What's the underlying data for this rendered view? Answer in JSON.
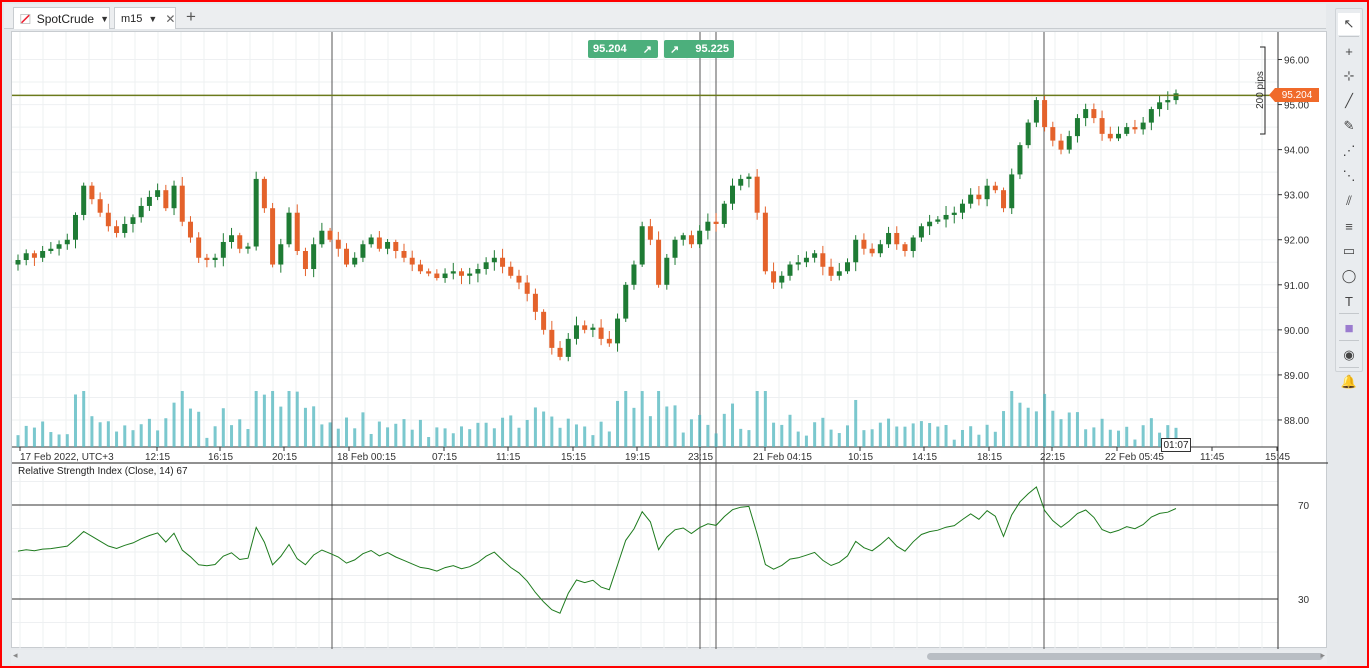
{
  "tabs": [
    {
      "label": "SpotCrude",
      "icon": "instrument-icon"
    },
    {
      "label": "m15",
      "icon": "timeframe-icon"
    }
  ],
  "add_tab_glyph": "+",
  "badges": {
    "sell": "95.204",
    "buy": "95.225"
  },
  "price_tag": "95.204",
  "time_tag": "01:07",
  "pips_label": "200 pips",
  "rsi_title": "Relative Strength Index (Close, 14) 67",
  "colors": {
    "up": "#1e7b34",
    "down": "#e4622b",
    "volume": "#4fb6bd",
    "rsi": "#1e7b1e",
    "hline": "#6b7a1c",
    "tag": "#f06a2a",
    "badge": "#4caf7c"
  },
  "toolbar": [
    "pointer-icon",
    "crosshair-icon",
    "crosshair-plus-icon",
    "line-icon",
    "brush-icon",
    "fib-icon",
    "fib-fan-icon",
    "channel-icon",
    "fib-retracement-icon",
    "rectangle-icon",
    "ellipse-icon",
    "text-icon",
    "color-swatch-icon",
    "camera-icon",
    "bell-icon"
  ],
  "chart_data": {
    "type": "candlestick",
    "price_axis": {
      "ticks": [
        "96.00",
        "95.00",
        "94.00",
        "93.00",
        "92.00",
        "91.00",
        "90.00",
        "89.00",
        "88.00"
      ],
      "range": [
        87.4,
        96.3
      ]
    },
    "time_axis": [
      "17 Feb 2022, UTC+3",
      "12:15",
      "16:15",
      "20:15",
      "18 Feb 00:15",
      "07:15",
      "11:15",
      "15:15",
      "19:15",
      "23:15",
      "21 Feb 04:15",
      "10:15",
      "14:15",
      "18:15",
      "22:15",
      "22 Feb 05:45",
      "11:45",
      "15:45"
    ],
    "horizontal_line": 95.204,
    "close_series": [
      91.55,
      91.7,
      91.6,
      91.75,
      91.8,
      91.9,
      92.0,
      92.55,
      93.2,
      92.9,
      92.6,
      92.3,
      92.15,
      92.35,
      92.5,
      92.75,
      92.95,
      93.1,
      92.7,
      93.2,
      92.4,
      92.05,
      91.6,
      91.55,
      91.6,
      91.95,
      92.1,
      91.8,
      91.85,
      93.35,
      92.7,
      91.45,
      91.9,
      92.6,
      91.75,
      91.35,
      91.9,
      92.2,
      92.0,
      91.8,
      91.45,
      91.6,
      91.9,
      92.05,
      91.8,
      91.95,
      91.75,
      91.6,
      91.45,
      91.3,
      91.25,
      91.15,
      91.25,
      91.3,
      91.2,
      91.25,
      91.35,
      91.5,
      91.6,
      91.4,
      91.2,
      91.05,
      90.8,
      90.4,
      90.0,
      89.6,
      89.4,
      89.8,
      90.1,
      90.0,
      90.05,
      89.8,
      89.7,
      90.25,
      91.0,
      91.45,
      92.3,
      92.0,
      91.0,
      91.6,
      92.0,
      92.1,
      91.9,
      92.2,
      92.4,
      92.35,
      92.8,
      93.2,
      93.35,
      93.4,
      92.6,
      91.3,
      91.05,
      91.2,
      91.45,
      91.5,
      91.6,
      91.7,
      91.4,
      91.2,
      91.3,
      91.5,
      92.0,
      91.8,
      91.7,
      91.9,
      92.15,
      91.9,
      91.75,
      92.05,
      92.3,
      92.4,
      92.45,
      92.55,
      92.6,
      92.8,
      93.0,
      92.9,
      93.2,
      93.1,
      92.7,
      93.45,
      94.1,
      94.6,
      95.1,
      94.5,
      94.2,
      94.0,
      94.3,
      94.7,
      94.9,
      94.7,
      94.35,
      94.25,
      94.35,
      94.5,
      94.45,
      94.6,
      94.9,
      95.05,
      95.1,
      95.25
    ]
  }
}
